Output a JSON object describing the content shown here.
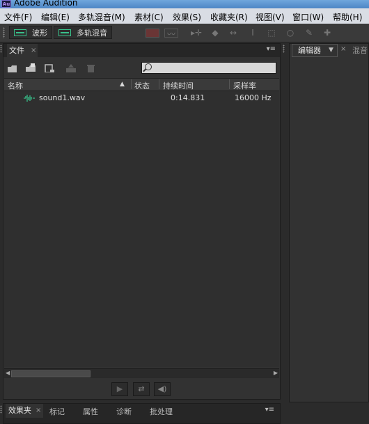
{
  "window": {
    "app_icon_text": "Au",
    "title": "Adobe Audition"
  },
  "menubar": {
    "items": [
      "文件(F)",
      "编辑(E)",
      "多轨混音(M)",
      "素材(C)",
      "效果(S)",
      "收藏夹(R)",
      "视图(V)",
      "窗口(W)",
      "帮助(H)"
    ]
  },
  "toolbar": {
    "waveform_label": "波形",
    "multitrack_label": "多轨混音",
    "tool_icons": [
      "spectral-display-icon",
      "spectral-pitch-icon",
      "move-tool-icon",
      "razor-tool-icon",
      "slip-tool-icon",
      "time-selection-icon",
      "marquee-tool-icon",
      "lasso-tool-icon",
      "brush-tool-icon",
      "healing-brush-icon"
    ]
  },
  "files_panel": {
    "tab_label": "文件",
    "tab_close": "×",
    "menu_glyph": "▾≡",
    "search_placeholder": "",
    "columns": [
      "名称",
      "状态",
      "持续时间",
      "采样率"
    ],
    "sort_indicator": "▲",
    "rows": [
      {
        "name": "sound1.wav",
        "status": "",
        "duration": "0:14.831",
        "sample_rate": "16000 Hz"
      }
    ],
    "accent_color": "#38c08a"
  },
  "editor_panel": {
    "tab_label": "编辑器",
    "dropdown_glyph": "▼",
    "close_glyph": "×",
    "second_tab_label": "混音"
  },
  "bottom_panel": {
    "tabs": [
      "效果夹",
      "标记",
      "属性",
      "诊断",
      "批处理"
    ],
    "close_glyph": "×",
    "menu_glyph": "▾≡"
  }
}
